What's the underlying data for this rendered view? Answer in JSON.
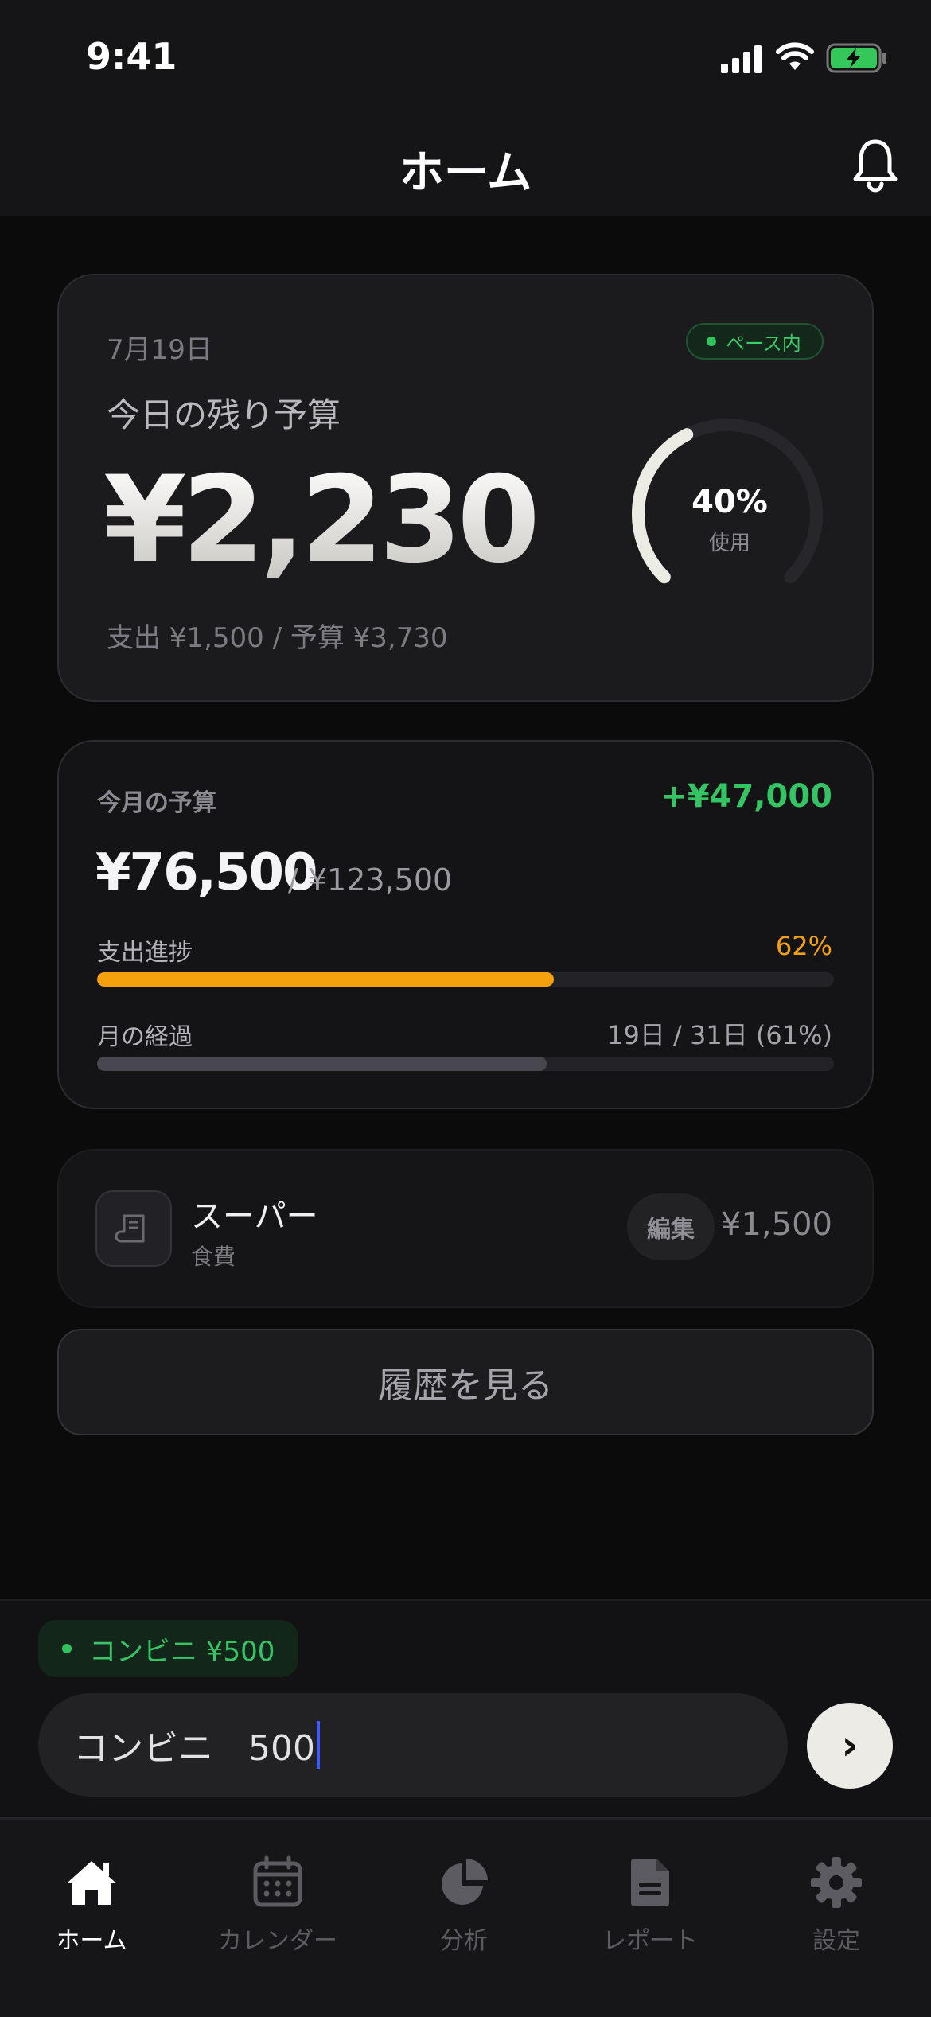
{
  "status_bar": {
    "time": "9:41"
  },
  "header": {
    "title": "ホーム"
  },
  "today": {
    "date": "7月19日",
    "pace_badge": "ペース内",
    "label": "今日の残り予算",
    "remaining": "¥2,230",
    "summary": "支出 ¥1,500 / 予算 ¥3,730",
    "gauge_percent": "40%",
    "gauge_label": "使用",
    "gauge_value": 0.4
  },
  "month": {
    "label": "今月の予算",
    "difference": "+¥47,000",
    "spent": "¥76,500",
    "total": "/ ¥123,500",
    "progress_label": "支出進捗",
    "progress_value": "62%",
    "progress_fraction": 0.62,
    "elapsed_label": "月の経過",
    "elapsed_value": "19日 / 31日 (61%)",
    "elapsed_fraction": 0.61
  },
  "transaction": {
    "name": "スーパー",
    "category": "食費",
    "edit_label": "編集",
    "amount": "¥1,500"
  },
  "history_button": "履歴を見る",
  "quick_input": {
    "suggestion": "コンビニ ¥500",
    "value": "コンビニ　500",
    "send_glyph": "›"
  },
  "tabs": [
    {
      "label": "ホーム",
      "icon": "home-icon",
      "active": true
    },
    {
      "label": "カレンダー",
      "icon": "calendar-icon",
      "active": false
    },
    {
      "label": "分析",
      "icon": "pie-chart-icon",
      "active": false
    },
    {
      "label": "レポート",
      "icon": "document-icon",
      "active": false
    },
    {
      "label": "設定",
      "icon": "gear-icon",
      "active": false
    }
  ],
  "colors": {
    "accent_green": "#34c463",
    "progress_orange": "#f5a10e",
    "elapsed_gray": "#48474f",
    "background": "#0b0b0c"
  }
}
